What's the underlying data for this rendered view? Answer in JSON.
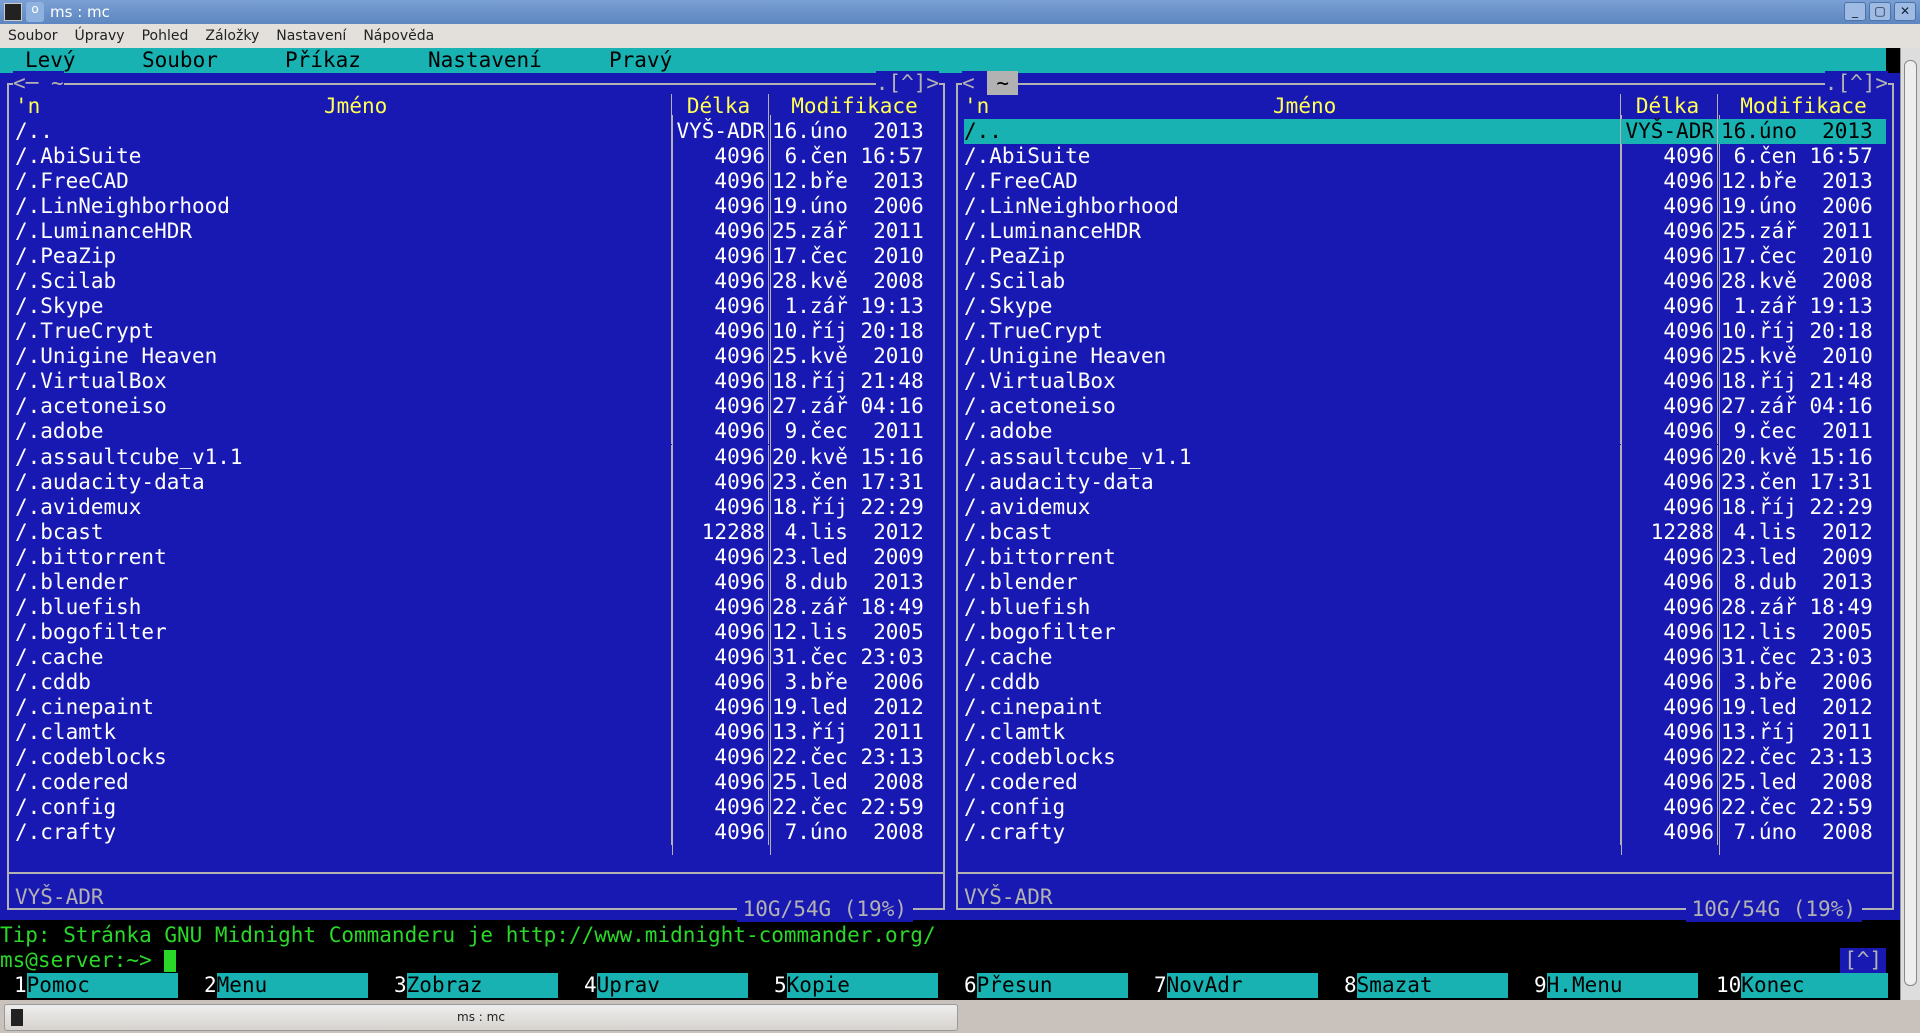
{
  "window": {
    "title": "ms : mc",
    "buttons": [
      "_",
      "▢",
      "✕"
    ]
  },
  "menubar": [
    "Soubor",
    "Úpravy",
    "Pohled",
    "Záložky",
    "Nastavení",
    "Nápověda"
  ],
  "mc_menu": [
    "Levý",
    "Soubor",
    "Příkaz",
    "Nastavení",
    "Pravý"
  ],
  "left_panel": {
    "path": "~",
    "history": ".[^]>",
    "left_arrow": "<─",
    "header": {
      "sort": "'n",
      "name": "Jméno",
      "size": "Délka",
      "mod": "Modifikace"
    },
    "mini_status": "VYŠ-ADR",
    "free": "10G/54G (19%)"
  },
  "right_panel": {
    "path": "~",
    "history": ".[^]>",
    "left_arrow": "<",
    "header": {
      "sort": "'n",
      "name": "Jméno",
      "size": "Délka",
      "mod": "Modifikace"
    },
    "mini_status": "VYŠ-ADR",
    "free": "10G/54G (19%)",
    "selected_index": 0
  },
  "files": [
    [
      "/..",
      "VYŠ-ADR",
      "16.úno  2013"
    ],
    [
      "/.AbiSuite",
      "4096",
      " 6.čen 16:57"
    ],
    [
      "/.FreeCAD",
      "4096",
      "12.bře  2013"
    ],
    [
      "/.LinNeighborhood",
      "4096",
      "19.úno  2006"
    ],
    [
      "/.LuminanceHDR",
      "4096",
      "25.zář  2011"
    ],
    [
      "/.PeaZip",
      "4096",
      "17.čec  2010"
    ],
    [
      "/.Scilab",
      "4096",
      "28.kvě  2008"
    ],
    [
      "/.Skype",
      "4096",
      " 1.zář 19:13"
    ],
    [
      "/.TrueCrypt",
      "4096",
      "10.říj 20:18"
    ],
    [
      "/.Unigine Heaven",
      "4096",
      "25.kvě  2010"
    ],
    [
      "/.VirtualBox",
      "4096",
      "18.říj 21:48"
    ],
    [
      "/.acetoneiso",
      "4096",
      "27.zář 04:16"
    ],
    [
      "/.adobe",
      "4096",
      " 9.čec  2011"
    ],
    [
      "/.assaultcube_v1.1",
      "4096",
      "20.kvě 15:16"
    ],
    [
      "/.audacity-data",
      "4096",
      "23.čen 17:31"
    ],
    [
      "/.avidemux",
      "4096",
      "18.říj 22:29"
    ],
    [
      "/.bcast",
      "12288",
      " 4.lis  2012"
    ],
    [
      "/.bittorrent",
      "4096",
      "23.led  2009"
    ],
    [
      "/.blender",
      "4096",
      " 8.dub  2013"
    ],
    [
      "/.bluefish",
      "4096",
      "28.zář 18:49"
    ],
    [
      "/.bogofilter",
      "4096",
      "12.lis  2005"
    ],
    [
      "/.cache",
      "4096",
      "31.čec 23:03"
    ],
    [
      "/.cddb",
      "4096",
      " 3.bře  2006"
    ],
    [
      "/.cinepaint",
      "4096",
      "19.led  2012"
    ],
    [
      "/.clamtk",
      "4096",
      "13.říj  2011"
    ],
    [
      "/.codeblocks",
      "4096",
      "22.čec 23:13"
    ],
    [
      "/.codered",
      "4096",
      "25.led  2008"
    ],
    [
      "/.config",
      "4096",
      "22.čec 22:59"
    ],
    [
      "/.crafty",
      "4096",
      " 7.úno  2008"
    ]
  ],
  "tip": "Tip: Stránka GNU Midnight Commanderu je http://www.midnight-commander.org/",
  "prompt": "ms@server:~> ",
  "history_button": "[^]",
  "fkeys": [
    [
      "1",
      "Pomoc"
    ],
    [
      "2",
      "Menu"
    ],
    [
      "3",
      "Zobraz"
    ],
    [
      "4",
      "Uprav"
    ],
    [
      "5",
      "Kopie"
    ],
    [
      "6",
      "Přesun"
    ],
    [
      "7",
      "NovAdr"
    ],
    [
      "8",
      "Smazat"
    ],
    [
      "9",
      "H.Menu"
    ],
    [
      "10",
      "Konec"
    ]
  ],
  "taskbar": {
    "item": "ms : mc"
  },
  "colors": {
    "panel_bg": "#1818b2",
    "accent": "#18b2b2",
    "header": "#ffff54",
    "prompt": "#2ad82a"
  }
}
